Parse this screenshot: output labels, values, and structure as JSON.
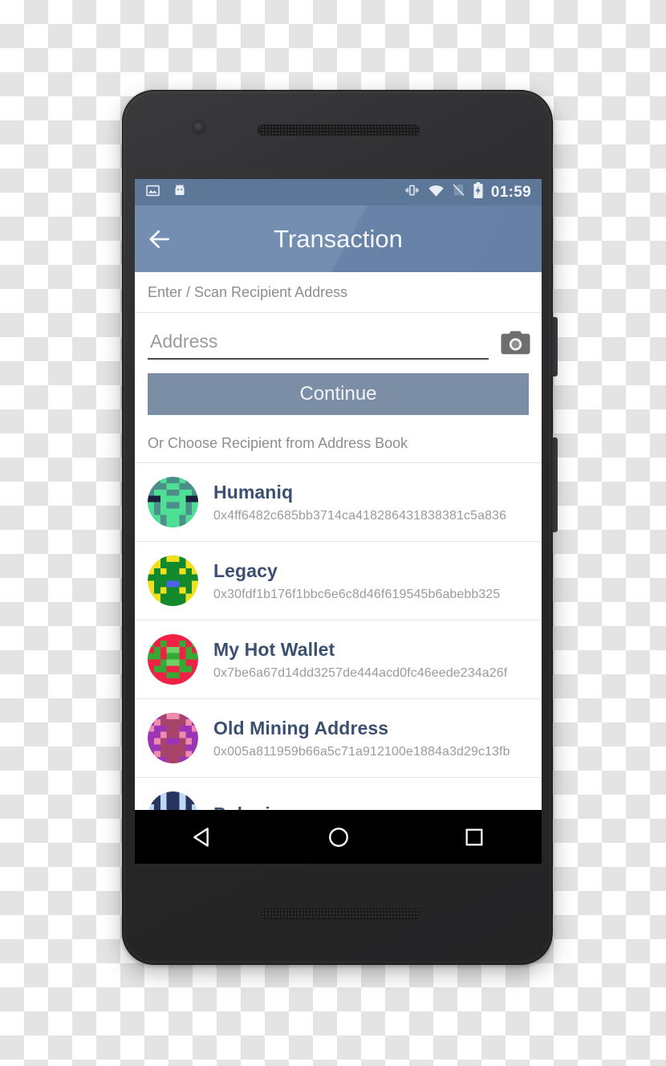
{
  "statusbar": {
    "time": "01:59",
    "icons": [
      "image-icon",
      "android-icon",
      "vibrate-icon",
      "wifi-icon",
      "no-sim-icon",
      "battery-charging-icon"
    ]
  },
  "appbar": {
    "title": "Transaction",
    "back_icon": "back-arrow-icon"
  },
  "form": {
    "section_label": "Enter / Scan Recipient Address",
    "address_value": "",
    "address_placeholder": "Address",
    "camera_icon": "camera-icon",
    "continue_label": "Continue",
    "book_label": "Or Choose Recipient from Address Book"
  },
  "contacts": [
    {
      "name": "Humaniq",
      "address": "0x4ff6482c685bb3714ca418286431838381c5a836",
      "avatar": "identicon-humaniq"
    },
    {
      "name": "Legacy",
      "address": "0x30fdf1b176f1bbc6e6c8d46f619545b6abebb325",
      "avatar": "identicon-legacy"
    },
    {
      "name": "My Hot Wallet",
      "address": "0x7be6a67d14dd3257de444acd0fc46eede234a26f",
      "avatar": "identicon-my-hot-wallet"
    },
    {
      "name": "Old Mining Address",
      "address": "0x005a811959b66a5c71a912100e1884a3d29c13fb",
      "avatar": "identicon-old-mining-address"
    },
    {
      "name": "Poloniex",
      "address": "",
      "avatar": "identicon-poloniex"
    }
  ],
  "navbar": {
    "back_label": "back-nav-key",
    "home_label": "home-nav-key",
    "recents_label": "recents-nav-key"
  },
  "colors": {
    "appbar": "#6a85ab",
    "statusbar": "#5d7799",
    "button": "#7b8ea6",
    "contact_name": "#3b5070",
    "muted_text": "#8d8d8d"
  }
}
